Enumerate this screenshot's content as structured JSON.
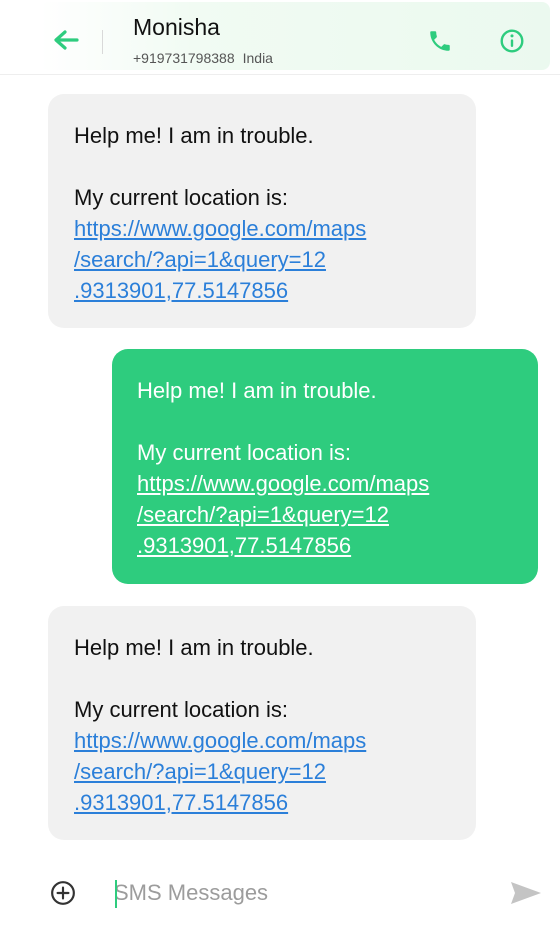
{
  "header": {
    "contact_name": "Monisha",
    "phone_number": "+919731798388",
    "country": "India",
    "icons": {
      "back": "arrow-left-icon",
      "call": "phone-icon",
      "info": "info-icon"
    }
  },
  "messages": [
    {
      "direction": "incoming",
      "line1": "Help me! I am in trouble.",
      "line2": "My current location is:",
      "link_part1": "https://www.google.com/maps",
      "link_part2": "/search/?api=1&query=12",
      "link_part3": ".9313901,77.5147856"
    },
    {
      "direction": "outgoing",
      "line1": "Help me! I am in trouble.",
      "line2": "My current location is:",
      "link_part1": "https://www.google.com/maps",
      "link_part2": "/search/?api=1&query=12",
      "link_part3": ".9313901,77.5147856"
    },
    {
      "direction": "incoming",
      "line1": "Help me! I am in trouble.",
      "line2": "My current location is:",
      "link_part1": "https://www.google.com/maps",
      "link_part2": "/search/?api=1&query=12",
      "link_part3": ".9313901,77.5147856"
    }
  ],
  "composer": {
    "placeholder": "SMS Messages",
    "icons": {
      "add": "add-circle-icon",
      "send": "send-icon"
    }
  },
  "colors": {
    "accent": "#2ecc7e",
    "incoming_bubble": "#f1f1f1",
    "link": "#2b7fd9"
  }
}
